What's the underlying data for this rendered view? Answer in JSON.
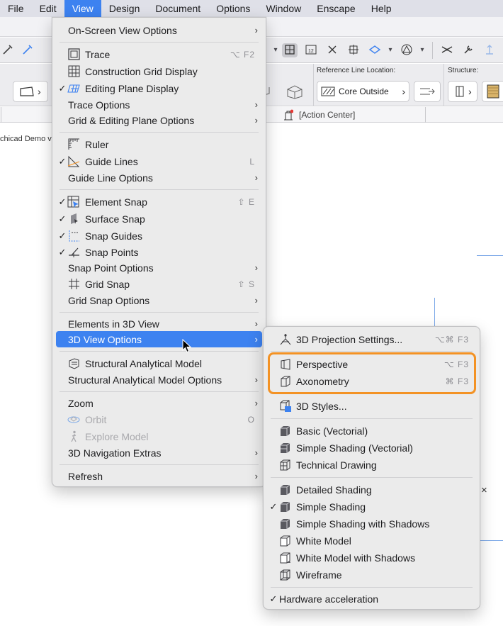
{
  "menubar": {
    "items": [
      "File",
      "Edit",
      "View",
      "Design",
      "Document",
      "Options",
      "Window",
      "Enscape",
      "Help"
    ],
    "active": "View"
  },
  "background": {
    "infobox": {
      "ref_line_label": "Reference Line Location:",
      "ref_line_value": "Core Outside",
      "structure_label": "Structure:"
    },
    "tab_label": "[Action Center]",
    "demo_text": "chicad Demo ve",
    "colors": {
      "canvas_line": "#7aa7e8",
      "menu_highlight": "#3d82f0",
      "callout": "#f39224"
    }
  },
  "view_menu": {
    "on_screen_view_options": "On-Screen View Options",
    "trace": "Trace",
    "trace_shortcut": "⌥ F2",
    "construction_grid": "Construction Grid Display",
    "editing_plane": "Editing Plane Display",
    "trace_options": "Trace Options",
    "grid_editing_plane_options": "Grid & Editing Plane Options",
    "ruler": "Ruler",
    "guide_lines": "Guide Lines",
    "guide_lines_shortcut": "L",
    "guide_line_options": "Guide Line Options",
    "element_snap": "Element Snap",
    "element_snap_shortcut": "⇧ E",
    "surface_snap": "Surface Snap",
    "snap_guides": "Snap Guides",
    "snap_points": "Snap Points",
    "snap_point_options": "Snap Point Options",
    "grid_snap": "Grid Snap",
    "grid_snap_shortcut": "⇧ S",
    "grid_snap_options": "Grid Snap Options",
    "elements_in_3d_view": "Elements in 3D View",
    "three_d_view_options": "3D View Options",
    "structural_analytical_model": "Structural Analytical Model",
    "structural_analytical_model_options": "Structural Analytical Model Options",
    "zoom": "Zoom",
    "orbit": "Orbit",
    "orbit_shortcut": "O",
    "explore_model": "Explore Model",
    "navigation_extras": "3D Navigation Extras",
    "refresh": "Refresh"
  },
  "sub_menu": {
    "projection_settings": "3D Projection Settings...",
    "projection_settings_shortcut": "⌥⌘ F3",
    "perspective": "Perspective",
    "perspective_shortcut": "⌥ F3",
    "axonometry": "Axonometry",
    "axonometry_shortcut": "⌘ F3",
    "styles": "3D Styles...",
    "basic_vectorial": "Basic (Vectorial)",
    "simple_shading_vectorial": "Simple Shading (Vectorial)",
    "technical_drawing": "Technical Drawing",
    "detailed_shading": "Detailed Shading",
    "simple_shading": "Simple Shading",
    "simple_shading_shadows": "Simple Shading with Shadows",
    "white_model": "White Model",
    "white_model_shadows": "White Model with Shadows",
    "wireframe": "Wireframe",
    "hardware_acceleration": "Hardware acceleration"
  },
  "glyphs": {
    "check": "✓",
    "arrow": "›",
    "close": "×"
  }
}
